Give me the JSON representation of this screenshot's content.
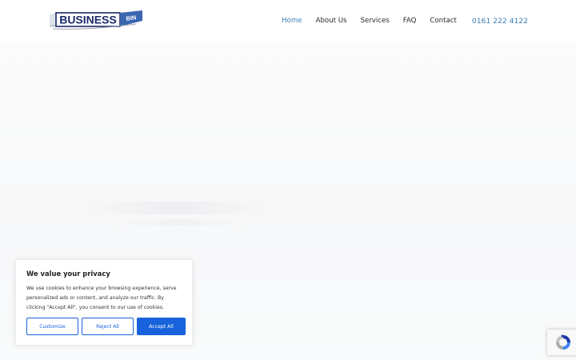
{
  "logo": {
    "text": "BUSINESS",
    "tag": "BIN"
  },
  "nav": {
    "items": [
      {
        "label": "Home",
        "active": true
      },
      {
        "label": "About Us"
      },
      {
        "label": "Services"
      },
      {
        "label": "FAQ"
      },
      {
        "label": "Contact"
      }
    ],
    "phone": "0161 222 4122"
  },
  "cookie": {
    "title": "We value your privacy",
    "body": "We use cookies to enhance your browsing experience, serve personalized ads or content, and analyze our traffic. By clicking \"Accept All\", you consent to our use of cookies.",
    "customize_label": "Customize",
    "reject_label": "Reject All",
    "accept_label": "Accept All"
  },
  "colors": {
    "accent": "#3c7fb4",
    "cookie_button": "#1863dc",
    "logo_dark": "#1b2a6b"
  },
  "icons": {
    "recaptcha": "recaptcha-icon"
  }
}
